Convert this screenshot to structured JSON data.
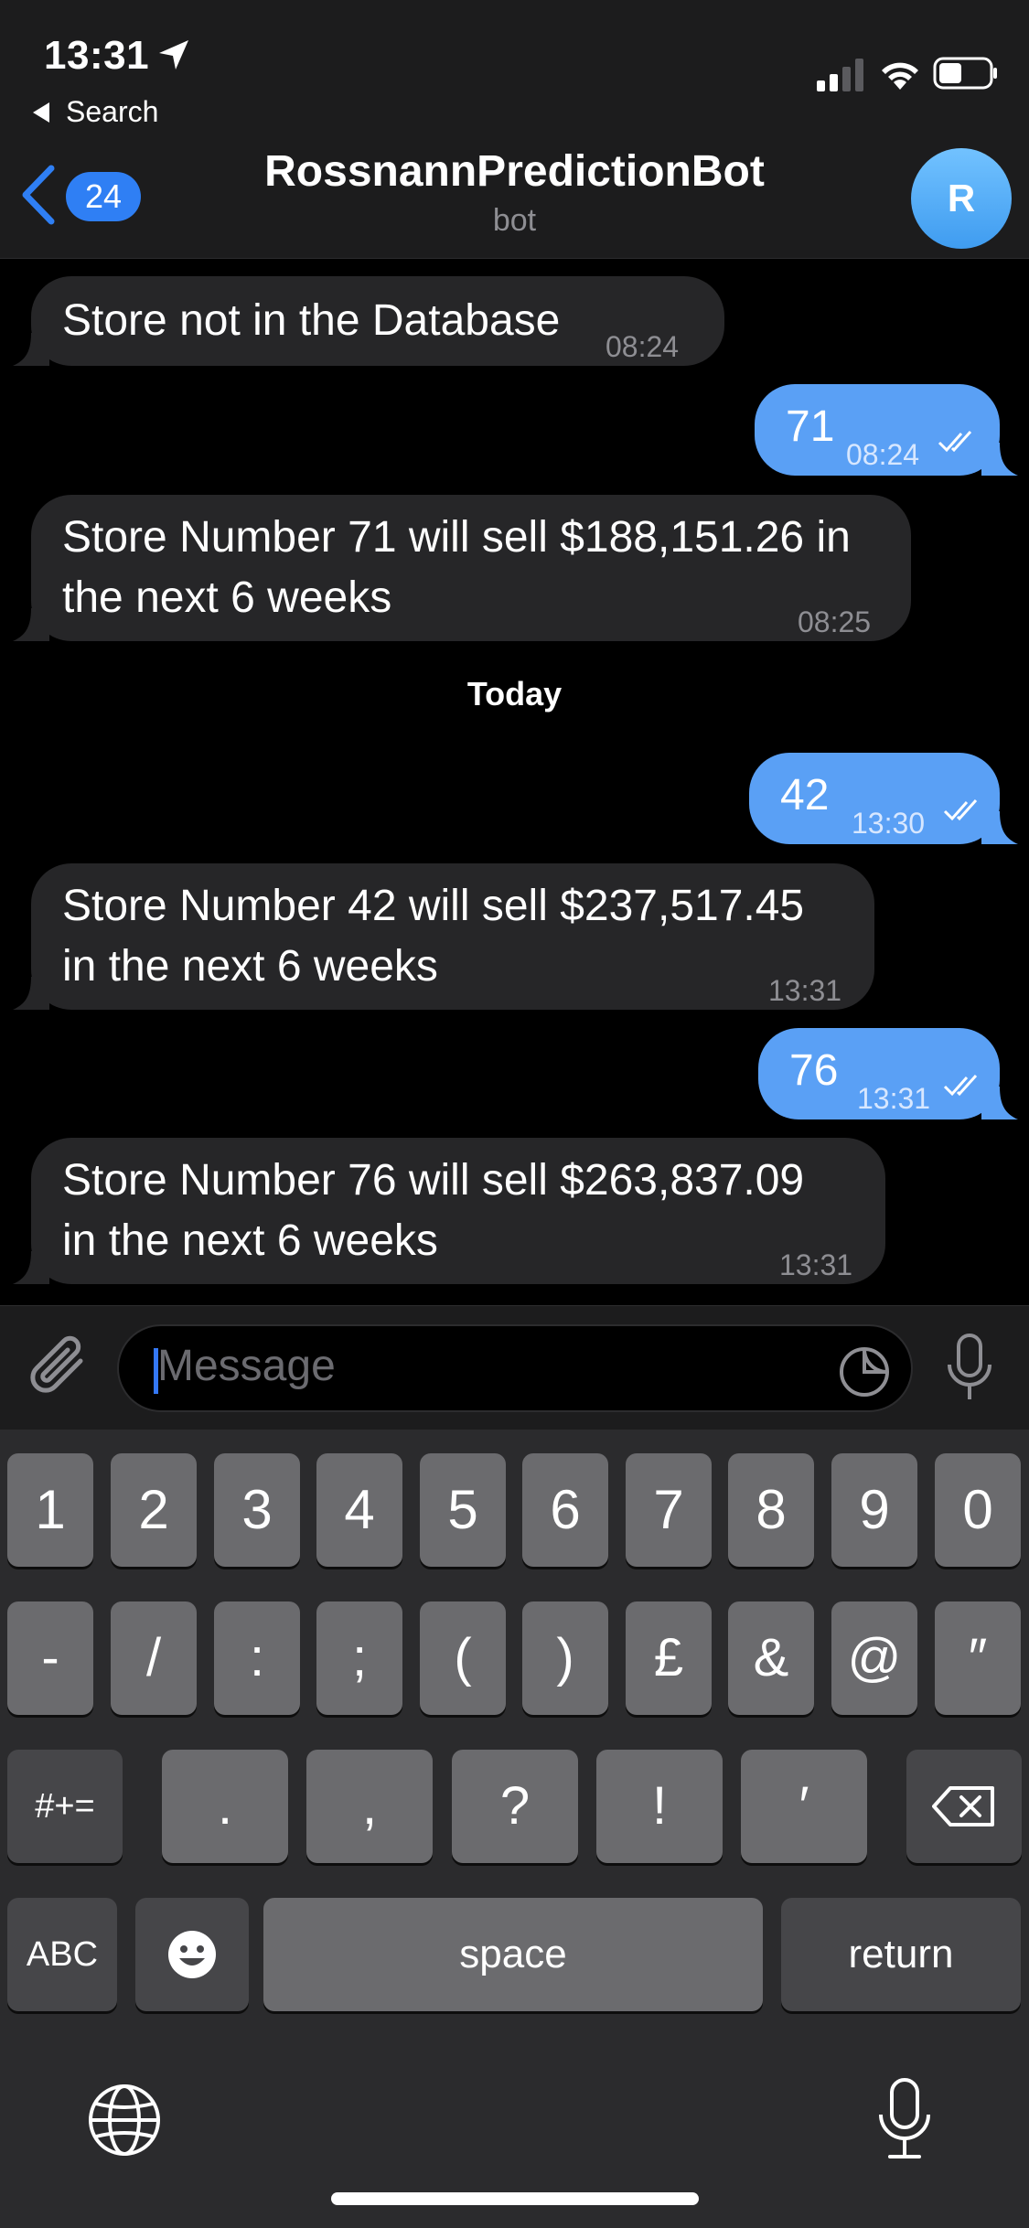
{
  "status_bar": {
    "time": "13:31",
    "back_app": "Search"
  },
  "header": {
    "unread_count": "24",
    "title": "RossnannPredictionBot",
    "subtitle": "bot",
    "avatar_initial": "R"
  },
  "messages": [
    {
      "direction": "incoming",
      "text": "Store not in the Database",
      "time": "08:24"
    },
    {
      "direction": "outgoing",
      "text": "71",
      "time": "08:24"
    },
    {
      "direction": "incoming",
      "lines": [
        "Store Number 71 will sell $188,151.26 in",
        "the next 6 weeks"
      ],
      "time": "08:25"
    },
    {
      "direction": "outgoing",
      "text": "42",
      "time": "13:30"
    },
    {
      "direction": "incoming",
      "lines": [
        "Store Number 42 will sell $237,517.45",
        "in the next 6 weeks"
      ],
      "time": "13:31"
    },
    {
      "direction": "outgoing",
      "text": "76",
      "time": "13:31"
    },
    {
      "direction": "incoming",
      "lines": [
        "Store Number 76 will sell $263,837.09",
        "in the next 6 weeks"
      ],
      "time": "13:31"
    }
  ],
  "date_separator": "Today",
  "input": {
    "placeholder": "Message"
  },
  "keyboard": {
    "row1": [
      "1",
      "2",
      "3",
      "4",
      "5",
      "6",
      "7",
      "8",
      "9",
      "0"
    ],
    "row2": [
      "-",
      "/",
      ":",
      ";",
      "(",
      ")",
      "£",
      "&",
      "@",
      "″"
    ],
    "row3": [
      ".",
      ",",
      "?",
      "!",
      "′"
    ],
    "mode_key": "#+=",
    "abc_key": "ABC",
    "space_key": "space",
    "return_key": "return"
  },
  "colors": {
    "accent": "#2f7ff4",
    "outgoing_bubble": "#5aa0f5",
    "incoming_bubble": "#262628"
  }
}
